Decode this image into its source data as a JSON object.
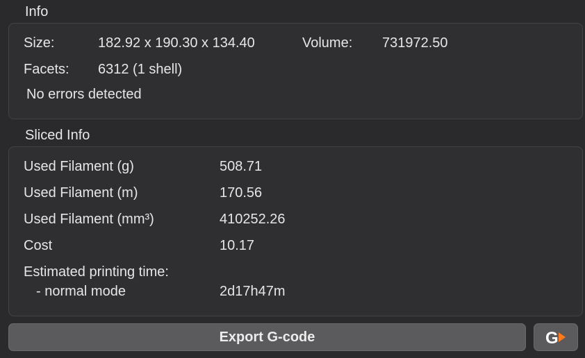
{
  "info": {
    "title": "Info",
    "size_label": "Size:",
    "size_value": "182.92 x 190.30 x 134.40",
    "volume_label": "Volume:",
    "volume_value": "731972.50",
    "facets_label": "Facets:",
    "facets_value": "6312 (1 shell)",
    "errors_text": "No errors detected"
  },
  "sliced_info": {
    "title": "Sliced Info",
    "rows": [
      {
        "label": "Used Filament (g)",
        "value": "508.71"
      },
      {
        "label": "Used Filament (m)",
        "value": "170.56"
      },
      {
        "label": "Used Filament (mm³)",
        "value": "410252.26"
      },
      {
        "label": "Cost",
        "value": "10.17"
      }
    ],
    "time_label": "Estimated printing time:",
    "mode_label": "- normal mode",
    "mode_value": "2d17h47m"
  },
  "actions": {
    "export_label": "Export G-code",
    "gcode_icon": "send-gcode-icon",
    "gcode_icon_color": "#ff7a1a"
  }
}
